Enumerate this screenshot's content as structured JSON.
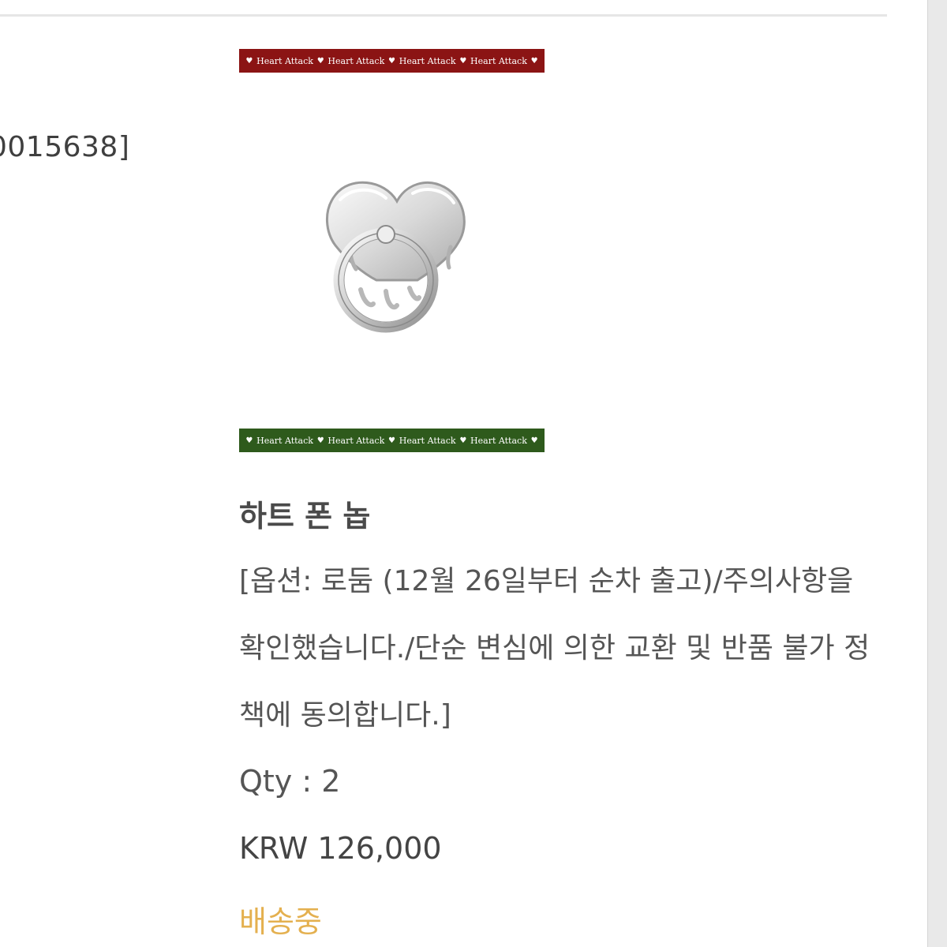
{
  "order": {
    "number_fragment": "0015638]"
  },
  "thumbnail": {
    "banner_text": "Heart Attack",
    "banner_top_color": "#8b1414",
    "banner_bottom_color": "#2e5a1c",
    "art_icon": "heart-ring-icon"
  },
  "product": {
    "name": "하트 폰 놉",
    "option": "[옵션: 로둠 (12월 26일부터 순차 출고)/주의사항을 확인했습니다./단순 변심에 의한 교환 및 반품 불가 정책에 동의합니다.]",
    "qty": "Qty : 2",
    "price": "KRW 126,000",
    "status": "배송중",
    "status_color": "#e4b04f"
  }
}
